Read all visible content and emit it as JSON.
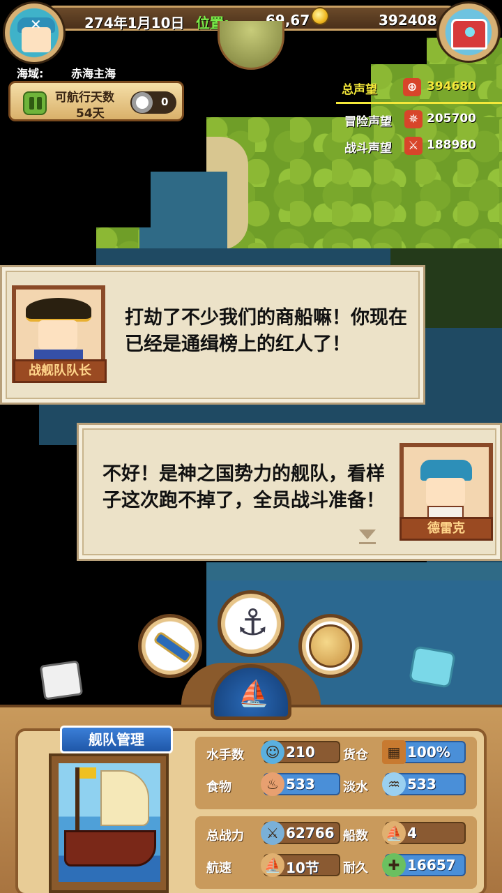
{
  "hud": {
    "date": "274年1月10日",
    "position_label": "位置:",
    "position_value": "69,67",
    "gold": "392408",
    "sea_label": "海域:",
    "sea_value": "赤海主海"
  },
  "voyage": {
    "days_label": "可航行天数",
    "days_value": "54天",
    "ring_count": "0"
  },
  "reputation": {
    "total_label": "总声望",
    "total_value": "394680",
    "adventure_label": "冒险声望",
    "adventure_value": "205700",
    "battle_label": "战斗声望",
    "battle_value": "188980"
  },
  "dialog1": {
    "speaker": "战舰队队长",
    "text": "打劫了不少我们的商船嘛！你现在已经是通缉榜上的红人了！"
  },
  "dialog2": {
    "speaker": "德雷克",
    "text": "不好！是神之国势力的舰队，看样子这次跑不掉了，全员战斗准备！"
  },
  "fleet": {
    "tab_label": "舰队管理",
    "sailors_label": "水手数",
    "sailors_value": "210",
    "cargo_label": "货仓",
    "cargo_value": "100%",
    "food_label": "食物",
    "food_value": "533",
    "water_label": "淡水",
    "water_value": "533",
    "power_label": "总战力",
    "power_value": "62766",
    "ships_label": "船数",
    "ships_value": "4",
    "speed_label": "航速",
    "speed_value": "10节",
    "durability_label": "耐久",
    "durability_value": "16657"
  },
  "colors": {
    "rep_total": "#f4e83a",
    "bar_blue": "#4a8fd8",
    "bar_brown": "#8a5a32",
    "fleet_tab": "#2b6bc0"
  },
  "icons": {
    "spyglass": "spyglass-icon",
    "anchor": "anchor-icon",
    "globe": "globe-icon",
    "ship": "ship-icon"
  }
}
